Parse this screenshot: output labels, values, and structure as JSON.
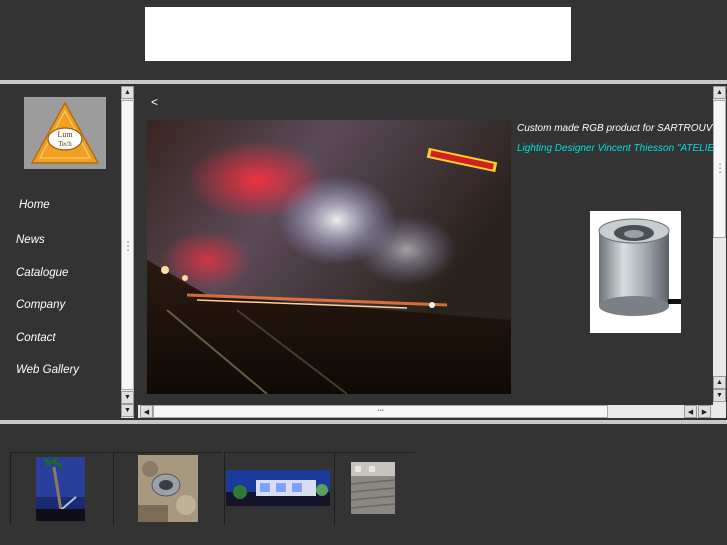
{
  "nav": {
    "items": [
      {
        "label": "Home"
      },
      {
        "label": "News"
      },
      {
        "label": "Catalogue"
      },
      {
        "label": "Company"
      },
      {
        "label": "Contact"
      },
      {
        "label": "Web Gallery"
      }
    ]
  },
  "logo": {
    "line1": "Lum",
    "line2": "Tech"
  },
  "main": {
    "back_link": "<",
    "caption_product": "Custom made RGB product  for SARTROUVILLE",
    "caption_designer": "Lighting Designer  Vincent Thiesson \"ATELIER"
  },
  "colors": {
    "background": "#333333",
    "separator": "#c8c8c8",
    "caption_accent": "#00e0e0",
    "logo_orange": "#f0a020"
  }
}
